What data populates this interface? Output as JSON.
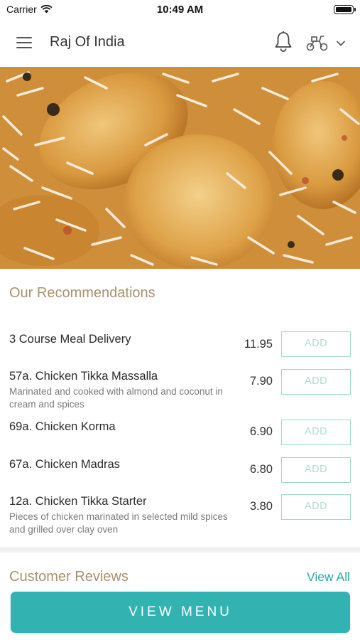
{
  "status_bar": {
    "carrier": "Carrier",
    "time": "10:49 AM"
  },
  "header": {
    "title": "Raj Of India"
  },
  "recommendations": {
    "title": "Our Recommendations",
    "items": [
      {
        "name": "3 Course Meal Delivery",
        "description": "",
        "price": "11.95",
        "button": "ADD"
      },
      {
        "name": "57a. Chicken Tikka Massalla",
        "description": "Marinated and cooked with almond and coconut in cream and spices",
        "price": "7.90",
        "button": "ADD"
      },
      {
        "name": "69a. Chicken Korma",
        "description": "",
        "price": "6.90",
        "button": "ADD"
      },
      {
        "name": "67a. Chicken Madras",
        "description": "",
        "price": "6.80",
        "button": "ADD"
      },
      {
        "name": "12a. Chicken Tikka Starter",
        "description": "Pieces of chicken marinated in selected mild spices and grilled over clay oven",
        "price": "3.80",
        "button": "ADD"
      }
    ]
  },
  "reviews": {
    "title": "Customer Reviews",
    "view_all": "View All"
  },
  "footer": {
    "button": "VIEW MENU"
  },
  "icons": [
    "wifi-icon",
    "battery-icon",
    "hamburger-menu-icon",
    "bell-icon",
    "scooter-icon",
    "chevron-down-icon"
  ],
  "colors": {
    "accent": "#33b2b2",
    "section_title": "#a89170",
    "add_border": "#9ed8c8",
    "link": "#2aa7ad"
  }
}
